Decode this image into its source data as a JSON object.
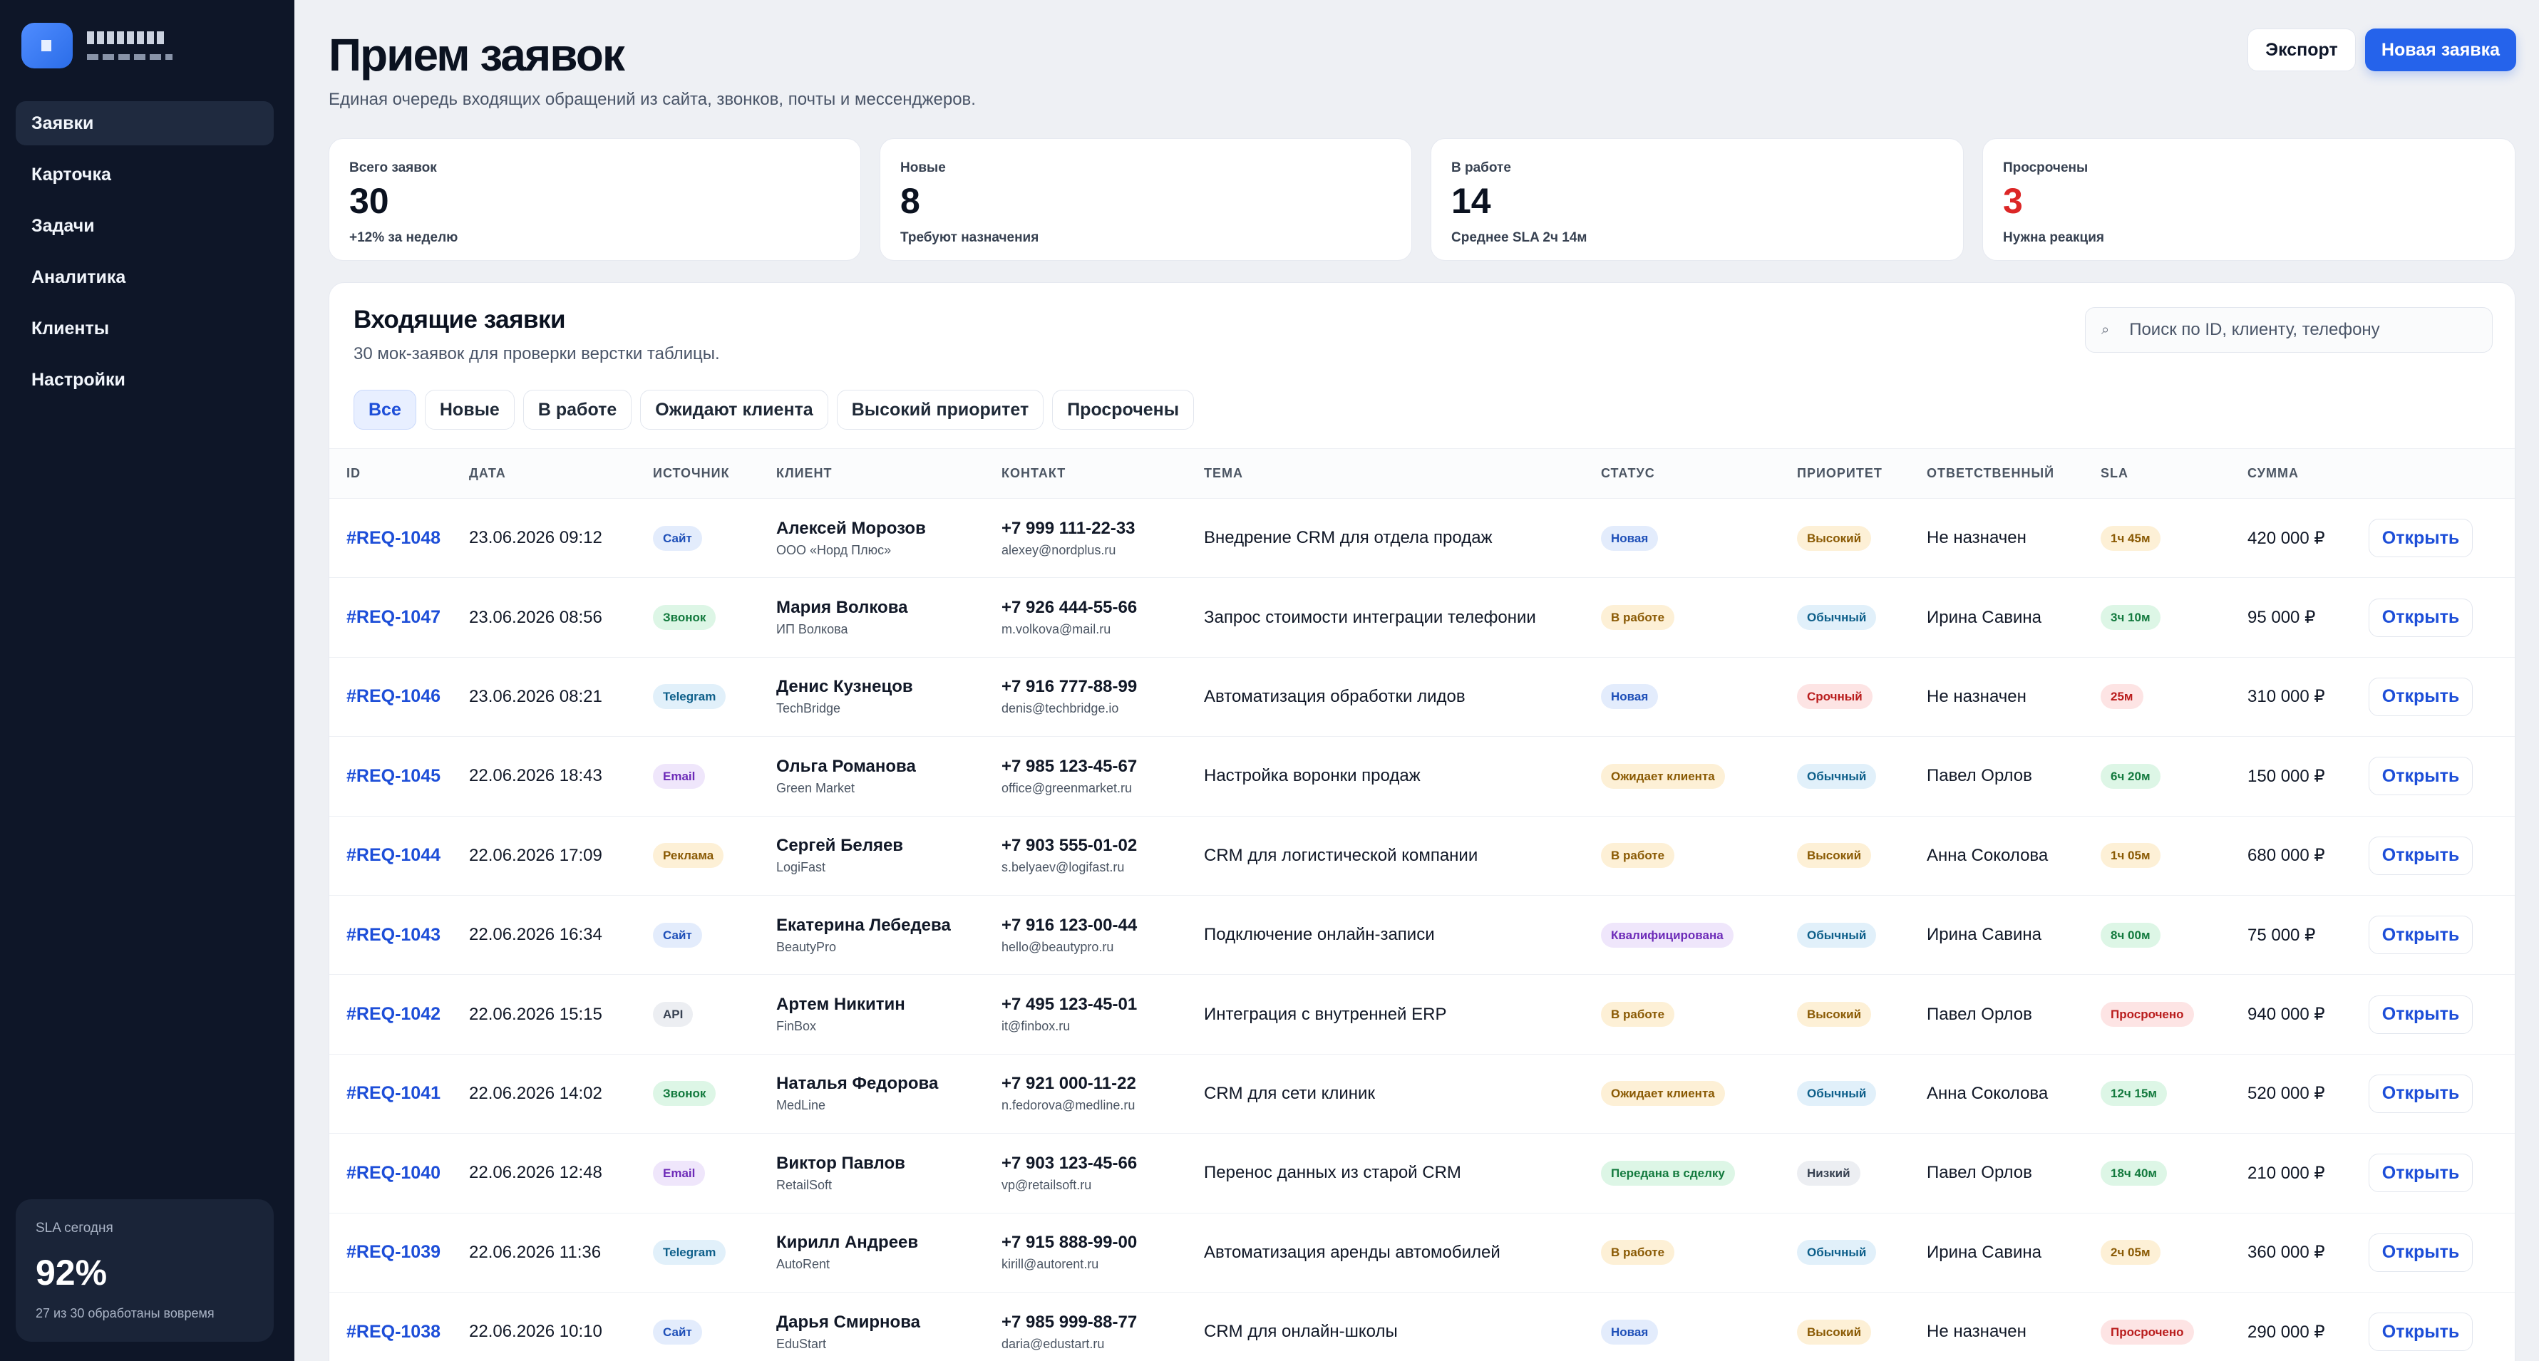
{
  "sidebar": {
    "items": [
      {
        "label": "Заявки"
      },
      {
        "label": "Карточка"
      },
      {
        "label": "Задачи"
      },
      {
        "label": "Аналитика"
      },
      {
        "label": "Клиенты"
      },
      {
        "label": "Настройки"
      }
    ],
    "sla": {
      "label": "SLA сегодня",
      "value": "92%",
      "sub": "27 из 30 обработаны вовремя"
    }
  },
  "header": {
    "title": "Прием заявок",
    "subtitle": "Единая очередь входящих обращений из сайта, звонков, почты и мессенджеров.",
    "export_label": "Экспорт",
    "new_label": "Новая заявка"
  },
  "stats": [
    {
      "label": "Всего заявок",
      "value": "30",
      "sub": "+12% за неделю"
    },
    {
      "label": "Новые",
      "value": "8",
      "sub": "Требуют назначения"
    },
    {
      "label": "В работе",
      "value": "14",
      "sub": "Среднее SLA 2ч 14м"
    },
    {
      "label": "Просрочены",
      "value": "3",
      "sub": "Нужна реакция"
    }
  ],
  "table_card": {
    "title": "Входящие заявки",
    "subtitle": "30 мок-заявок для проверки верстки таблицы.",
    "search_placeholder": "Поиск по ID, клиенту, телефону",
    "search_icon": "⌕",
    "tabs": [
      {
        "label": "Все"
      },
      {
        "label": "Новые"
      },
      {
        "label": "В работе"
      },
      {
        "label": "Ожидают клиента"
      },
      {
        "label": "Высокий приоритет"
      },
      {
        "label": "Просрочены"
      }
    ],
    "columns": [
      "ID",
      "ДАТА",
      "ИСТОЧНИК",
      "КЛИЕНТ",
      "КОНТАКТ",
      "ТЕМА",
      "СТАТУС",
      "ПРИОРИТЕТ",
      "ОТВЕТСТВЕННЫЙ",
      "SLA",
      "СУММА",
      ""
    ],
    "open_label": "Открыть",
    "rows": [
      {
        "id": "#REQ-1048",
        "date": "23.06.2026 09:12",
        "source": "Сайт",
        "src": "site",
        "client": "Алексей Морозов",
        "company": "ООО «Норд Плюс»",
        "phone": "+7 999 111-22-33",
        "email": "alexey@nordplus.ru",
        "theme": "Внедрение CRM для отдела продаж",
        "status": "Новая",
        "st": "new",
        "priority": "Высокий",
        "pr": "high",
        "owner": "Не назначен",
        "sla": "1ч 45м",
        "sl": "warn",
        "sum": "420 000 ₽"
      },
      {
        "id": "#REQ-1047",
        "date": "23.06.2026 08:56",
        "source": "Звонок",
        "src": "call",
        "client": "Мария Волкова",
        "company": "ИП Волкова",
        "phone": "+7 926 444-55-66",
        "email": "m.volkova@mail.ru",
        "theme": "Запрос стоимости интеграции телефонии",
        "status": "В работе",
        "st": "work",
        "priority": "Обычный",
        "pr": "norm",
        "owner": "Ирина Савина",
        "sla": "3ч 10м",
        "sl": "ok",
        "sum": "95 000 ₽"
      },
      {
        "id": "#REQ-1046",
        "date": "23.06.2026 08:21",
        "source": "Telegram",
        "src": "tg",
        "client": "Денис Кузнецов",
        "company": "TechBridge",
        "phone": "+7 916 777-88-99",
        "email": "denis@techbridge.io",
        "theme": "Автоматизация обработки лидов",
        "status": "Новая",
        "st": "new",
        "priority": "Срочный",
        "pr": "urg",
        "owner": "Не назначен",
        "sla": "25м",
        "sl": "bad",
        "sum": "310 000 ₽"
      },
      {
        "id": "#REQ-1045",
        "date": "22.06.2026 18:43",
        "source": "Email",
        "src": "email",
        "client": "Ольга Романова",
        "company": "Green Market",
        "phone": "+7 985 123-45-67",
        "email": "office@greenmarket.ru",
        "theme": "Настройка воронки продаж",
        "status": "Ожидает клиента",
        "st": "wait",
        "priority": "Обычный",
        "pr": "norm",
        "owner": "Павел Орлов",
        "sla": "6ч 20м",
        "sl": "ok",
        "sum": "150 000 ₽"
      },
      {
        "id": "#REQ-1044",
        "date": "22.06.2026 17:09",
        "source": "Реклама",
        "src": "ad",
        "client": "Сергей Беляев",
        "company": "LogiFast",
        "phone": "+7 903 555-01-02",
        "email": "s.belyaev@logifast.ru",
        "theme": "CRM для логистической компании",
        "status": "В работе",
        "st": "work",
        "priority": "Высокий",
        "pr": "high",
        "owner": "Анна Соколова",
        "sla": "1ч 05м",
        "sl": "warn",
        "sum": "680 000 ₽"
      },
      {
        "id": "#REQ-1043",
        "date": "22.06.2026 16:34",
        "source": "Сайт",
        "src": "site",
        "client": "Екатерина Лебедева",
        "company": "BeautyPro",
        "phone": "+7 916 123-00-44",
        "email": "hello@beautypro.ru",
        "theme": "Подключение онлайн-записи",
        "status": "Квалифицирована",
        "st": "qual",
        "priority": "Обычный",
        "pr": "norm",
        "owner": "Ирина Савина",
        "sla": "8ч 00м",
        "sl": "ok",
        "sum": "75 000 ₽"
      },
      {
        "id": "#REQ-1042",
        "date": "22.06.2026 15:15",
        "source": "API",
        "src": "api",
        "client": "Артем Никитин",
        "company": "FinBox",
        "phone": "+7 495 123-45-01",
        "email": "it@finbox.ru",
        "theme": "Интеграция с внутренней ERP",
        "status": "В работе",
        "st": "work",
        "priority": "Высокий",
        "pr": "high",
        "owner": "Павел Орлов",
        "sla": "Просрочено",
        "sl": "bad",
        "sum": "940 000 ₽"
      },
      {
        "id": "#REQ-1041",
        "date": "22.06.2026 14:02",
        "source": "Звонок",
        "src": "call",
        "client": "Наталья Федорова",
        "company": "MedLine",
        "phone": "+7 921 000-11-22",
        "email": "n.fedorova@medline.ru",
        "theme": "CRM для сети клиник",
        "status": "Ожидает клиента",
        "st": "wait",
        "priority": "Обычный",
        "pr": "norm",
        "owner": "Анна Соколова",
        "sla": "12ч 15м",
        "sl": "ok",
        "sum": "520 000 ₽"
      },
      {
        "id": "#REQ-1040",
        "date": "22.06.2026 12:48",
        "source": "Email",
        "src": "email",
        "client": "Виктор Павлов",
        "company": "RetailSoft",
        "phone": "+7 903 123-45-66",
        "email": "vp@retailsoft.ru",
        "theme": "Перенос данных из старой CRM",
        "status": "Передана в сделку",
        "st": "deal",
        "priority": "Низкий",
        "pr": "low",
        "owner": "Павел Орлов",
        "sla": "18ч 40м",
        "sl": "ok",
        "sum": "210 000 ₽"
      },
      {
        "id": "#REQ-1039",
        "date": "22.06.2026 11:36",
        "source": "Telegram",
        "src": "tg",
        "client": "Кирилл Андреев",
        "company": "AutoRent",
        "phone": "+7 915 888-99-00",
        "email": "kirill@autorent.ru",
        "theme": "Автоматизация аренды автомобилей",
        "status": "В работе",
        "st": "work",
        "priority": "Обычный",
        "pr": "norm",
        "owner": "Ирина Савина",
        "sla": "2ч 05м",
        "sl": "warn",
        "sum": "360 000 ₽"
      },
      {
        "id": "#REQ-1038",
        "date": "22.06.2026 10:10",
        "source": "Сайт",
        "src": "site",
        "client": "Дарья Смирнова",
        "company": "EduStart",
        "phone": "+7 985 999-88-77",
        "email": "daria@edustart.ru",
        "theme": "CRM для онлайн-школы",
        "status": "Новая",
        "st": "new",
        "priority": "Высокий",
        "pr": "high",
        "owner": "Не назначен",
        "sla": "Просрочено",
        "sl": "bad",
        "sum": "290 000 ₽"
      }
    ]
  }
}
